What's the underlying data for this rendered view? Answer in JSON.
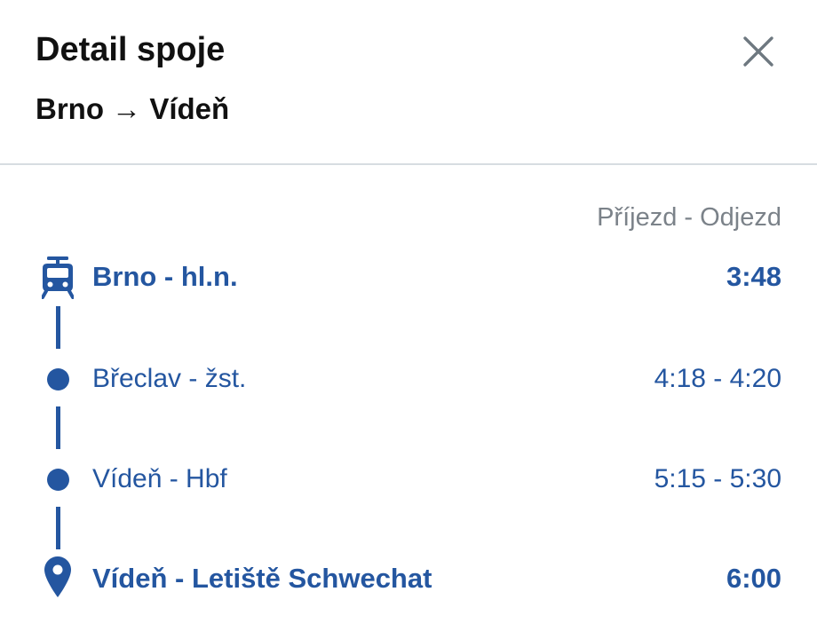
{
  "header": {
    "title": "Detail spoje",
    "route": "Brno → Vídeň"
  },
  "close_icon": "close-icon",
  "column_header": "Příjezd - Odjezd",
  "accent_color": "#2456a0",
  "stops": [
    {
      "name": "Brno - hl.n.",
      "time": "3:48",
      "icon": "train-icon"
    },
    {
      "name": "Břeclav - žst.",
      "time": "4:18 - 4:20",
      "icon": "dot"
    },
    {
      "name": "Vídeň - Hbf",
      "time": "5:15 - 5:30",
      "icon": "dot"
    },
    {
      "name": "Vídeň - Letiště Schwechat",
      "time": "6:00",
      "icon": "map-pin-icon"
    }
  ]
}
